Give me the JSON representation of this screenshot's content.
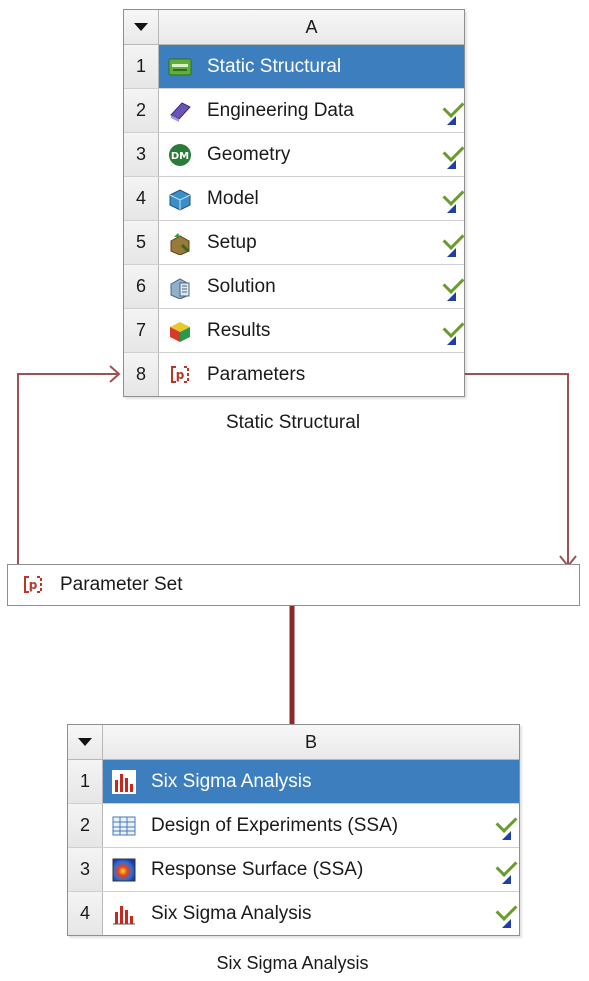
{
  "system_a": {
    "column": "A",
    "rows": [
      {
        "num": "1",
        "label": "Static Structural",
        "icon": "static-structural-icon"
      },
      {
        "num": "2",
        "label": "Engineering Data",
        "icon": "engineering-data-icon"
      },
      {
        "num": "3",
        "label": "Geometry",
        "icon": "geometry-icon"
      },
      {
        "num": "4",
        "label": "Model",
        "icon": "model-icon"
      },
      {
        "num": "5",
        "label": "Setup",
        "icon": "setup-icon"
      },
      {
        "num": "6",
        "label": "Solution",
        "icon": "solution-icon"
      },
      {
        "num": "7",
        "label": "Results",
        "icon": "results-icon"
      },
      {
        "num": "8",
        "label": "Parameters",
        "icon": "parameters-icon"
      }
    ],
    "caption": "Static Structural"
  },
  "parameter_set": {
    "label": "Parameter Set",
    "icon": "parameter-set-icon"
  },
  "system_b": {
    "column": "B",
    "rows": [
      {
        "num": "1",
        "label": "Six Sigma Analysis",
        "icon": "six-sigma-icon"
      },
      {
        "num": "2",
        "label": "Design of Experiments (SSA)",
        "icon": "doe-icon"
      },
      {
        "num": "3",
        "label": "Response Surface (SSA)",
        "icon": "response-surface-icon"
      },
      {
        "num": "4",
        "label": "Six Sigma Analysis",
        "icon": "six-sigma-icon"
      }
    ],
    "caption": "Six Sigma Analysis"
  },
  "colors": {
    "selected_row": "#3d7ebf",
    "checkmark": "#6a9b2e",
    "link_line": "#a05050",
    "update_triangle": "#1f3ea8"
  }
}
